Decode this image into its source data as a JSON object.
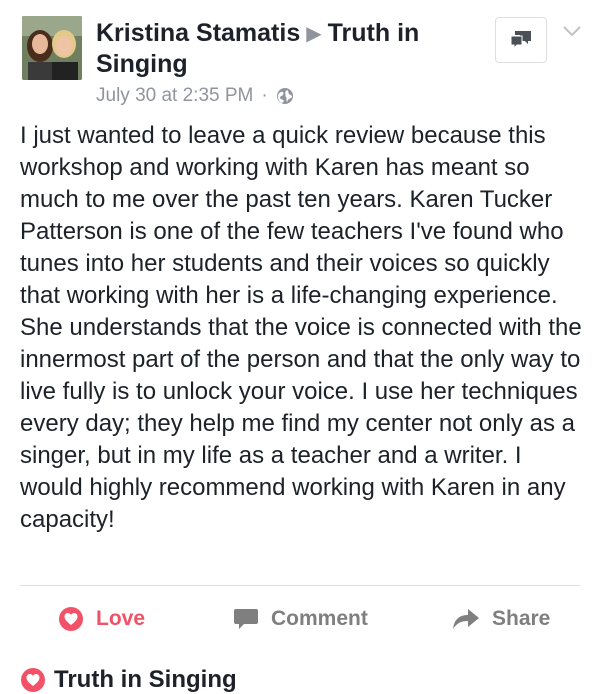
{
  "post": {
    "author": "Kristina Stamatis",
    "page": "Truth in Singing",
    "timestamp": "July 30 at 2:35 PM",
    "separator": "·",
    "privacy_icon": "globe-icon",
    "text": "I just wanted to leave a quick review because this workshop and working with Karen has meant so much to me over the past ten years. Karen Tucker Patterson is one of the few teachers I've found who tunes into her students and their voices so quickly that working with her is a life-changing experience. She understands that the voice is connected with the innermost part of the person and that the only way to live fully is to unlock your voice. I use her techniques every day; they help me find my center not only as a singer, but in my life as a teacher and a writer. I would highly recommend working with Karen in any capacity!"
  },
  "actions": {
    "love_label": "Love",
    "comment_label": "Comment",
    "share_label": "Share"
  },
  "next_post": {
    "title": "Truth in Singing"
  },
  "colors": {
    "love": "#f25268",
    "muted": "#90949c",
    "text": "#1d2129"
  }
}
